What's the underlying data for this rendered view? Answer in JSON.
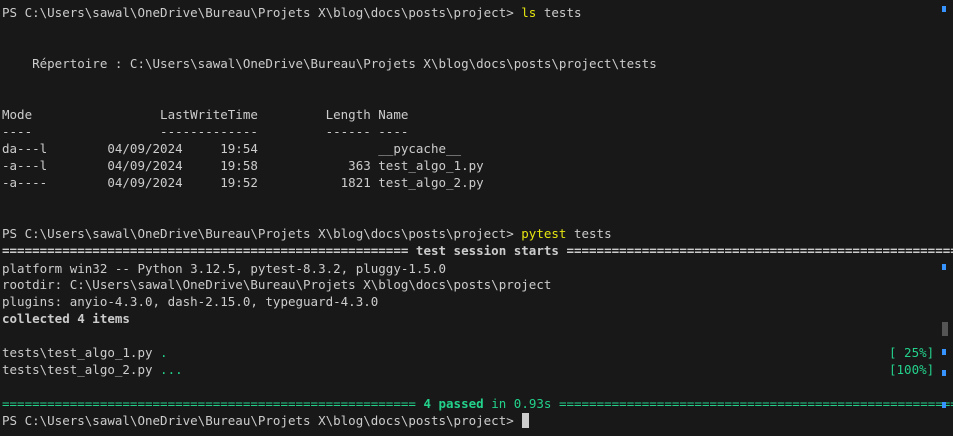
{
  "terminal": {
    "prompt": "PS C:\\Users\\sawal\\OneDrive\\Bureau\\Projets X\\blog\\docs\\posts\\project>",
    "cmd1": {
      "name": "ls",
      "args": "tests"
    },
    "directory_line": "    Répertoire : C:\\Users\\sawal\\OneDrive\\Bureau\\Projets X\\blog\\docs\\posts\\project\\tests",
    "table": {
      "header": "Mode                 LastWriteTime         Length Name",
      "separator": "----                 -------------         ------ ----",
      "rows": [
        "da---l        04/09/2024     19:54                __pycache__",
        "-a---l        04/09/2024     19:58            363 test_algo_1.py",
        "-a----        04/09/2024     19:52           1821 test_algo_2.py"
      ]
    },
    "cmd2": {
      "name": "pytest",
      "args": "tests"
    },
    "session_start": {
      "left_rule": "======================================================",
      "label": "test session starts",
      "right_rule": "======================================================="
    },
    "platform_line": "platform win32 -- Python 3.12.5, pytest-8.3.2, pluggy-1.5.0",
    "rootdir_line": "rootdir: C:\\Users\\sawal\\OneDrive\\Bureau\\Projets X\\blog\\docs\\posts\\project",
    "plugins_line": "plugins: anyio-4.3.0, dash-2.15.0, typeguard-4.3.0",
    "collected_line": "collected 4 items",
    "results": [
      {
        "file": "tests\\test_algo_1.py",
        "dots": ".",
        "progress": "[ 25%]"
      },
      {
        "file": "tests\\test_algo_2.py",
        "dots": "...",
        "progress": "[100%]"
      }
    ],
    "summary": {
      "left_rule": "=======================================================",
      "passed": "4 passed",
      "in": "in",
      "time": "0.93s",
      "right_rule": "========================================================"
    }
  },
  "colors": {
    "background": "#181818",
    "text": "#cccccc",
    "command": "#e5e510",
    "success": "#23d18b",
    "dots": "#29b8db",
    "scroll_mark": "#3794ff"
  }
}
